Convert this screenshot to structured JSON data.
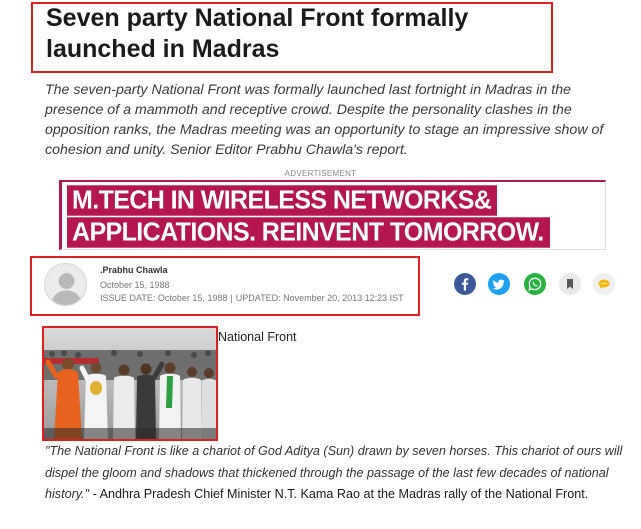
{
  "article": {
    "headline": "Seven party National Front formally launched in Madras",
    "summary": "The seven-party National Front was formally launched last fortnight in Madras in the presence of a mammoth and receptive crowd. Despite the personality clashes in the opposition ranks, the Madras meeting was an opportunity to stage an impressive show of cohesion and unity. Senior Editor Prabhu Chawla's report."
  },
  "advertisement": {
    "label": "ADVERTISEMENT",
    "line1": "M.TECH IN WIRELESS NETWORKS&",
    "line2": "APPLICATIONS. REINVENT TOMORROW.",
    "color": "#b4174f"
  },
  "author": {
    "name": ".Prabhu Chawla",
    "date": "October 15, 1988",
    "issue_date": "ISSUE DATE: October 15, 1988",
    "separator": "|",
    "updated": "UPDATED: November 20, 2013 12:23 IST"
  },
  "share": {
    "icons": [
      "facebook-icon",
      "twitter-icon",
      "whatsapp-icon",
      "bookmark-icon",
      "comment-icon"
    ],
    "colors": {
      "facebook": "#3b5998",
      "twitter": "#1da1f2",
      "whatsapp": "#27b43e",
      "comment": "#f2b705"
    }
  },
  "photo": {
    "caption": "National Front"
  },
  "quote": {
    "text": "\"The National Front is like a chariot of God Aditya (Sun) drawn by seven horses. This chariot of ours will dispel the gloom and shadows that thickened through the passage of the last few decades of national history.\"",
    "attribution": " - Andhra Pradesh Chief Minister N.T. Kama Rao at the Madras rally of the National Front."
  },
  "highlight_color": "#e02020"
}
